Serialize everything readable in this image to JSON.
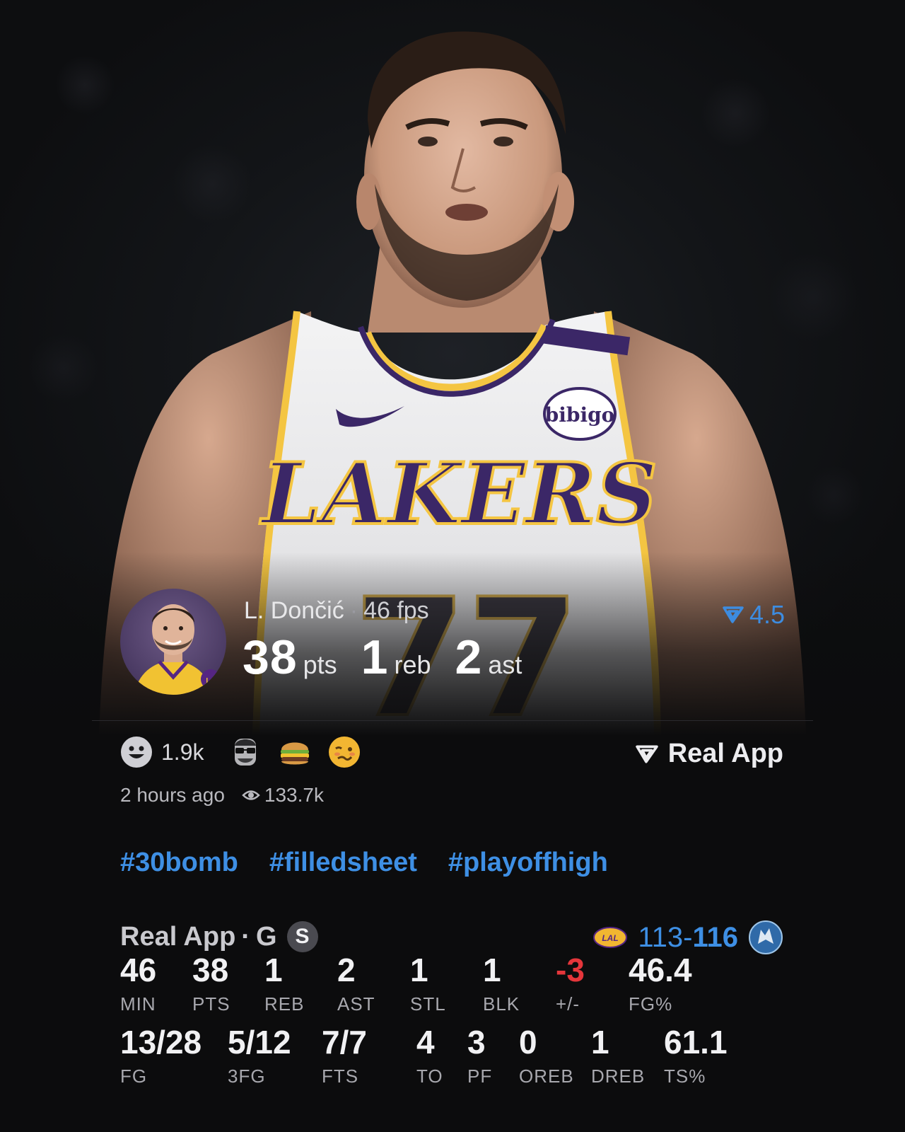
{
  "player": {
    "name": "L. Dončić",
    "fps": "46 fps",
    "points": "38",
    "points_unit": "pts",
    "rebounds": "1",
    "rebounds_unit": "reb",
    "assists": "2",
    "assists_unit": "ast",
    "boost_value": "4.5",
    "jersey_text": "LAKERS",
    "jersey_sponsor": "bibigo",
    "jersey_number": "77"
  },
  "reactions": {
    "count": "1.9k",
    "icons": [
      "smile-icon",
      "sunglasses-emoji-icon",
      "burger-emoji-icon",
      "woozy-emoji-icon"
    ],
    "source_label": "Real App"
  },
  "meta": {
    "time_ago": "2 hours ago",
    "views": "133.7k"
  },
  "hashtags": [
    "#30bomb",
    "#filledsheet",
    "#playoffhigh"
  ],
  "game": {
    "source": "Real App",
    "position": "G",
    "badge": "S",
    "score_lose": "113",
    "score_sep": "-",
    "score_win": "116"
  },
  "stats_row1": [
    {
      "value": "46",
      "label": "MIN"
    },
    {
      "value": "38",
      "label": "PTS"
    },
    {
      "value": "1",
      "label": "REB"
    },
    {
      "value": "2",
      "label": "AST"
    },
    {
      "value": "1",
      "label": "STL"
    },
    {
      "value": "1",
      "label": "BLK"
    },
    {
      "value": "-3",
      "label": "+/-"
    },
    {
      "value": "46.4",
      "label": "FG%"
    }
  ],
  "stats_row2": [
    {
      "value": "13/28",
      "label": "FG"
    },
    {
      "value": "5/12",
      "label": "3FG"
    },
    {
      "value": "7/7",
      "label": "FTS"
    },
    {
      "value": "4",
      "label": "TO"
    },
    {
      "value": "3",
      "label": "PF"
    },
    {
      "value": "0",
      "label": "OREB"
    },
    {
      "value": "1",
      "label": "DREB"
    },
    {
      "value": "61.1",
      "label": "TS%"
    }
  ],
  "colors": {
    "accent_blue": "#3e8fe4",
    "negative_red": "#e5363b",
    "lakers_purple": "#552583",
    "lakers_gold": "#fdb927"
  }
}
